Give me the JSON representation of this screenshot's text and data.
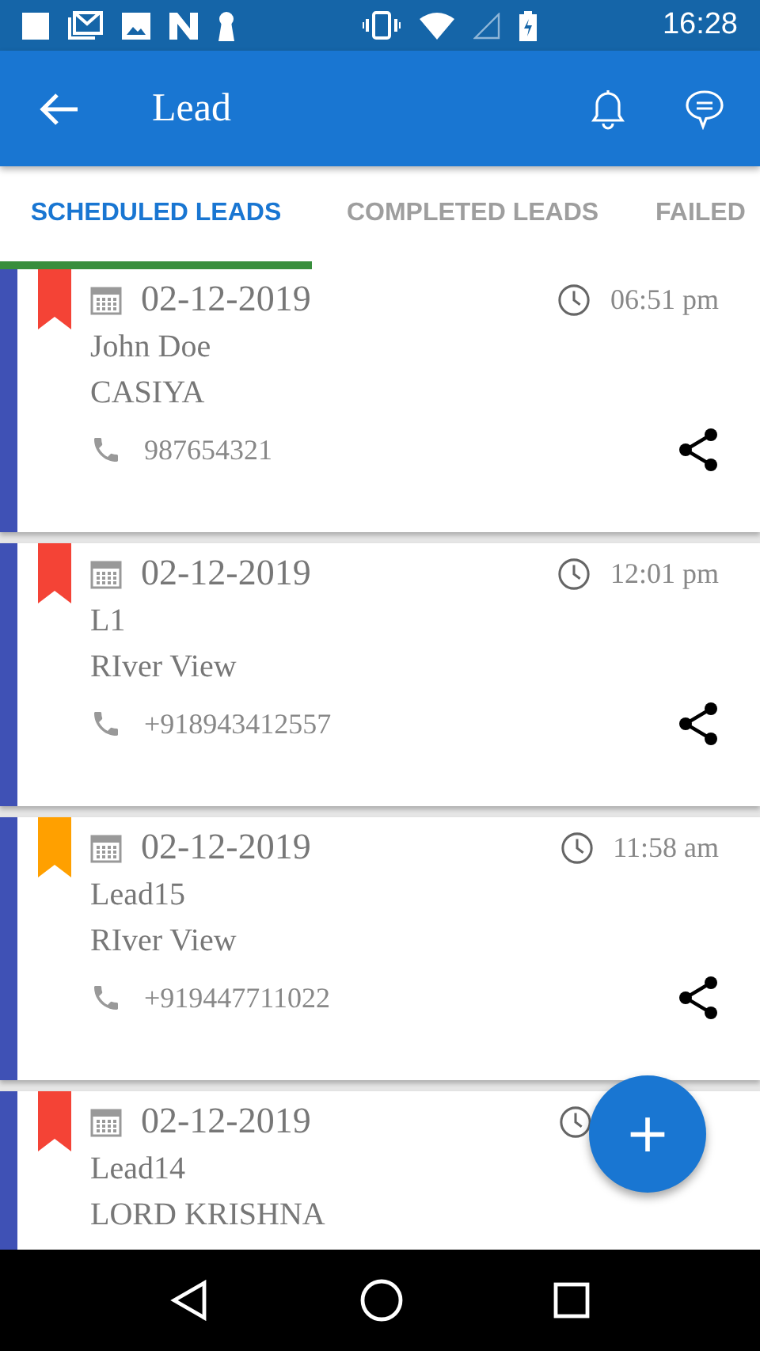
{
  "status_bar": {
    "time": "16:28"
  },
  "app_bar": {
    "title": "Lead"
  },
  "tabs": [
    {
      "label": "SCHEDULED LEADS",
      "selected": true
    },
    {
      "label": "COMPLETED LEADS",
      "selected": false
    },
    {
      "label": "FAILED",
      "selected": false
    }
  ],
  "leads": [
    {
      "color": "#f44336",
      "date": "02-12-2019",
      "time": "06:51 pm",
      "name": "John Doe",
      "company": "CASIYA",
      "phone": "987654321"
    },
    {
      "color": "#f44336",
      "date": "02-12-2019",
      "time": "12:01 pm",
      "name": "L1",
      "company": "RIver View",
      "phone": "+918943412557"
    },
    {
      "color": "#ffa000",
      "date": "02-12-2019",
      "time": "11:58 am",
      "name": "Lead15",
      "company": "RIver View",
      "phone": "+919447711022"
    },
    {
      "color": "#f44336",
      "date": "02-12-2019",
      "name": "Lead14",
      "company": "LORD KRISHNA"
    }
  ],
  "fab": {
    "label": "+"
  }
}
